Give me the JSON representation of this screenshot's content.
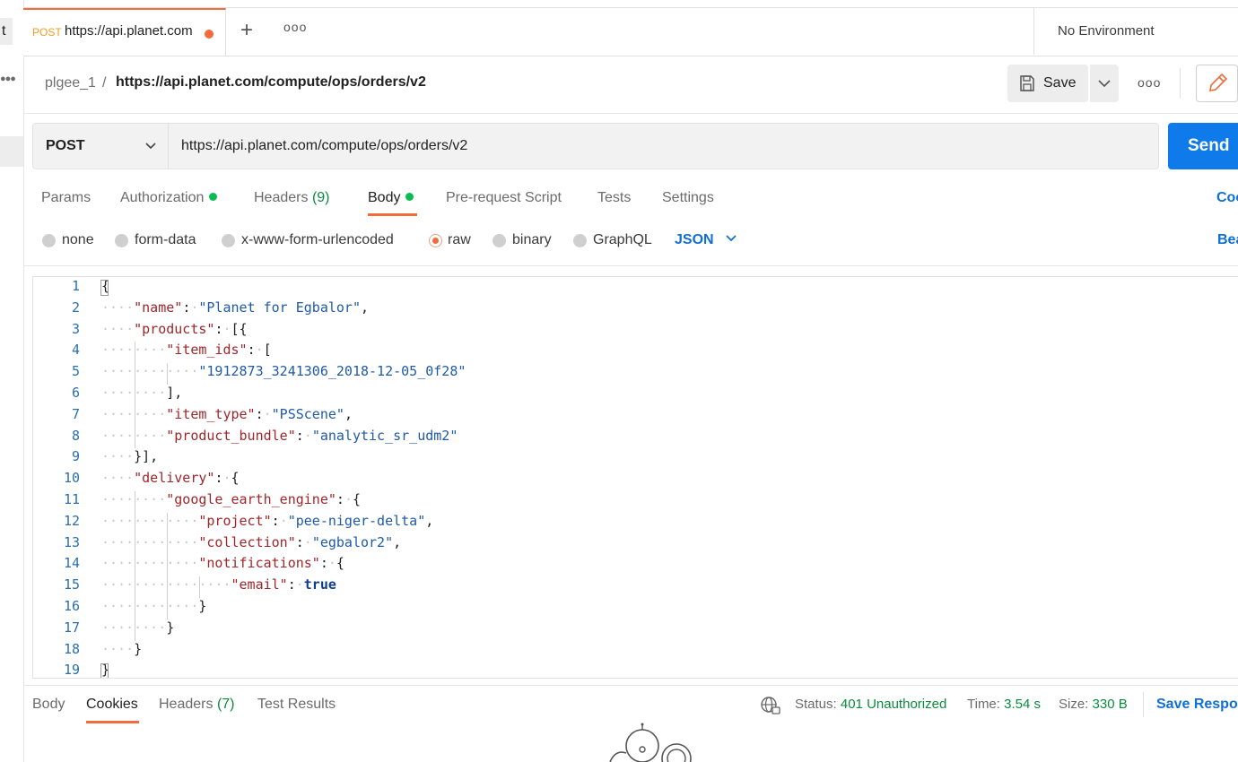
{
  "left_panel": {
    "collapsed_label": "t"
  },
  "tab_bar": {
    "active_tab": {
      "method": "POST",
      "url": "https://api.planet.com"
    },
    "environment": "No Environment"
  },
  "header": {
    "collection": "plgee_1",
    "separator": "/",
    "request_name": "https://api.planet.com/compute/ops/orders/v2",
    "save_label": "Save"
  },
  "request": {
    "method": "POST",
    "url": "https://api.planet.com/compute/ops/orders/v2",
    "send_label": "Send"
  },
  "request_tabs": [
    {
      "label": "Params"
    },
    {
      "label": "Authorization"
    },
    {
      "label": "Headers",
      "count": "(9)"
    },
    {
      "label": "Body"
    },
    {
      "label": "Pre-request Script"
    },
    {
      "label": "Tests"
    },
    {
      "label": "Settings"
    }
  ],
  "cookies_link": "Coo",
  "body_types": [
    "none",
    "form-data",
    "x-www-form-urlencoded",
    "raw",
    "binary",
    "GraphQL"
  ],
  "selected_body_type": "raw",
  "body_language": "JSON",
  "beautify_link": "Bea",
  "editor": {
    "lines": [
      "{",
      "    \"name\": \"Planet for Egbalor\",",
      "    \"products\": [{",
      "        \"item_ids\": [",
      "            \"1912873_3241306_2018-12-05_0f28\"",
      "        ],",
      "        \"item_type\": \"PSScene\",",
      "        \"product_bundle\": \"analytic_sr_udm2\"",
      "    }],",
      "    \"delivery\": {",
      "        \"google_earth_engine\": {",
      "            \"project\": \"pee-niger-delta\",",
      "            \"collection\": \"egbalor2\",",
      "            \"notifications\": {",
      "                \"email\": true",
      "            }",
      "        }",
      "    }",
      "}"
    ]
  },
  "response": {
    "tabs": [
      {
        "label": "Body"
      },
      {
        "label": "Cookies"
      },
      {
        "label": "Headers",
        "count": "(7)"
      },
      {
        "label": "Test Results"
      }
    ],
    "status_label": "Status:",
    "status_value": "401 Unauthorized",
    "time_label": "Time:",
    "time_value": "3.54 s",
    "size_label": "Size:",
    "size_value": "330 B",
    "save_response": "Save Respon"
  },
  "colors": {
    "accent": "#f26b3a",
    "send": "#0f7bea",
    "link": "#0f6fd6",
    "success": "#0b8a3d"
  }
}
